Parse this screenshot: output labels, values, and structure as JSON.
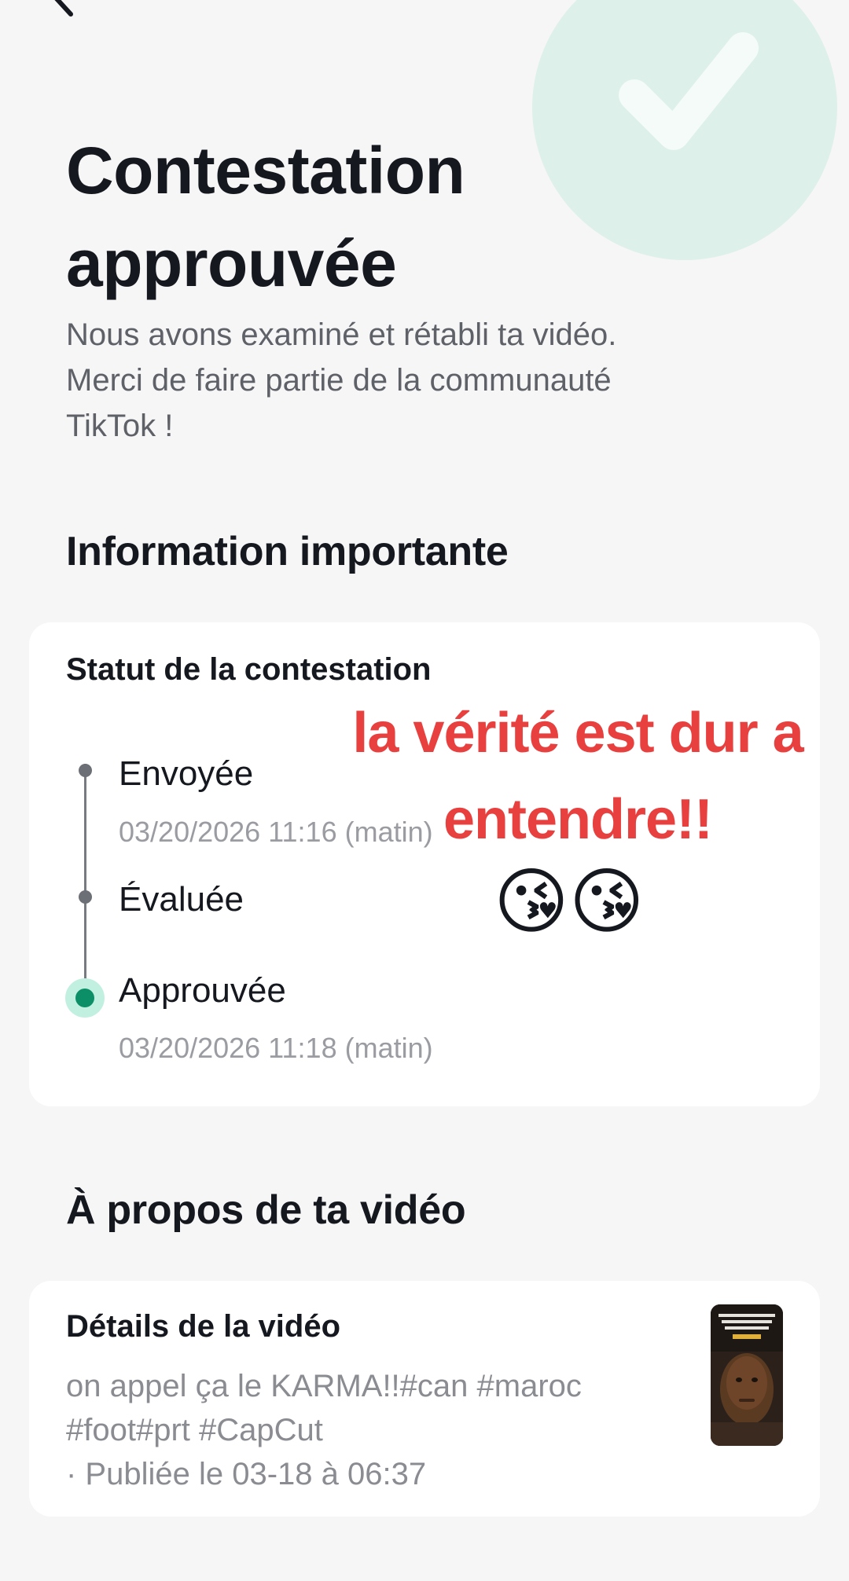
{
  "header": {
    "title_line1": "Contestation",
    "title_line2": "approuvée",
    "subtitle_line1": "Nous avons examiné et rétabli ta vidéo.",
    "subtitle_line2": "Merci de faire partie de la communauté",
    "subtitle_line3": "TikTok !"
  },
  "info": {
    "section_title": "Information importante",
    "card_title": "Statut de la contestation",
    "steps": [
      {
        "label": "Envoyée",
        "time": "03/20/2026 11:16 (matin)"
      },
      {
        "label": "Évaluée",
        "time": ""
      },
      {
        "label": "Approuvée",
        "time": "03/20/2026 11:18 (matin)"
      }
    ]
  },
  "overlay": {
    "line1": "la vérité  est dur a",
    "line2": "entendre!!",
    "emoji": "😘😘"
  },
  "video": {
    "section_title": "À propos de ta vidéo",
    "card_title": "Détails de la vidéo",
    "caption_line1": "on appel ça le KARMA!!#can #maroc",
    "caption_line2": "#foot#prt #CapCut",
    "published": "· Publiée le 03-18 à 06:37"
  },
  "colors": {
    "accent_green": "#0c8f67",
    "overlay_red": "#e8403f",
    "background": "#f6f6f6"
  },
  "icons": {
    "back": "chevron-left-icon",
    "check": "check-icon"
  }
}
